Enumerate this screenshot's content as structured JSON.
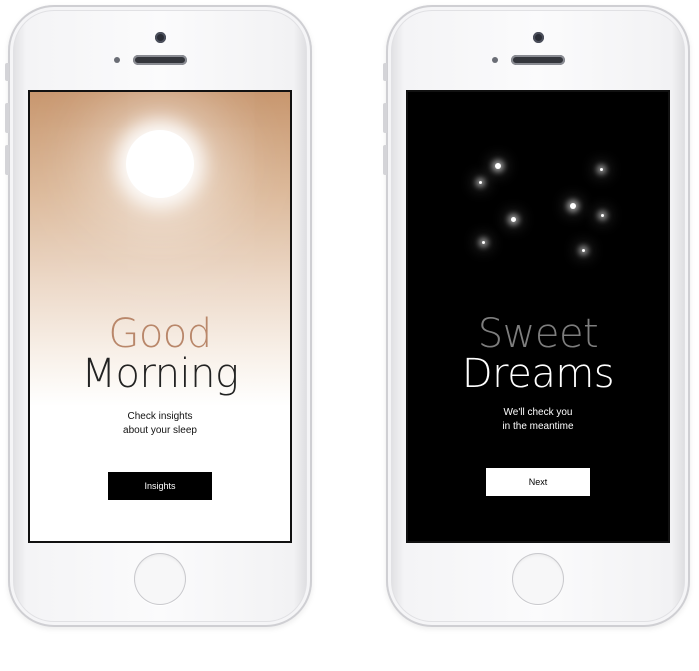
{
  "screens": [
    {
      "theme": "day",
      "title_line1": "Good",
      "title_line2": "Morning",
      "subtitle_line1": "Check insights",
      "subtitle_line2": "about your sleep",
      "button_label": "Insights",
      "colors": {
        "title_accent": "#b9876a",
        "button_bg": "#000000",
        "gradient_top": "#c7956c"
      },
      "icons": [
        "sun-icon"
      ]
    },
    {
      "theme": "night",
      "title_line1": "Sweet",
      "title_line2": "Dreams",
      "subtitle_line1": "We'll check you",
      "subtitle_line2": "in the meantime",
      "button_label": "Next",
      "colors": {
        "title_accent": "#7e7e7e",
        "button_bg": "#ffffff",
        "background": "#000000"
      },
      "icons": [
        "star-icon"
      ]
    }
  ]
}
